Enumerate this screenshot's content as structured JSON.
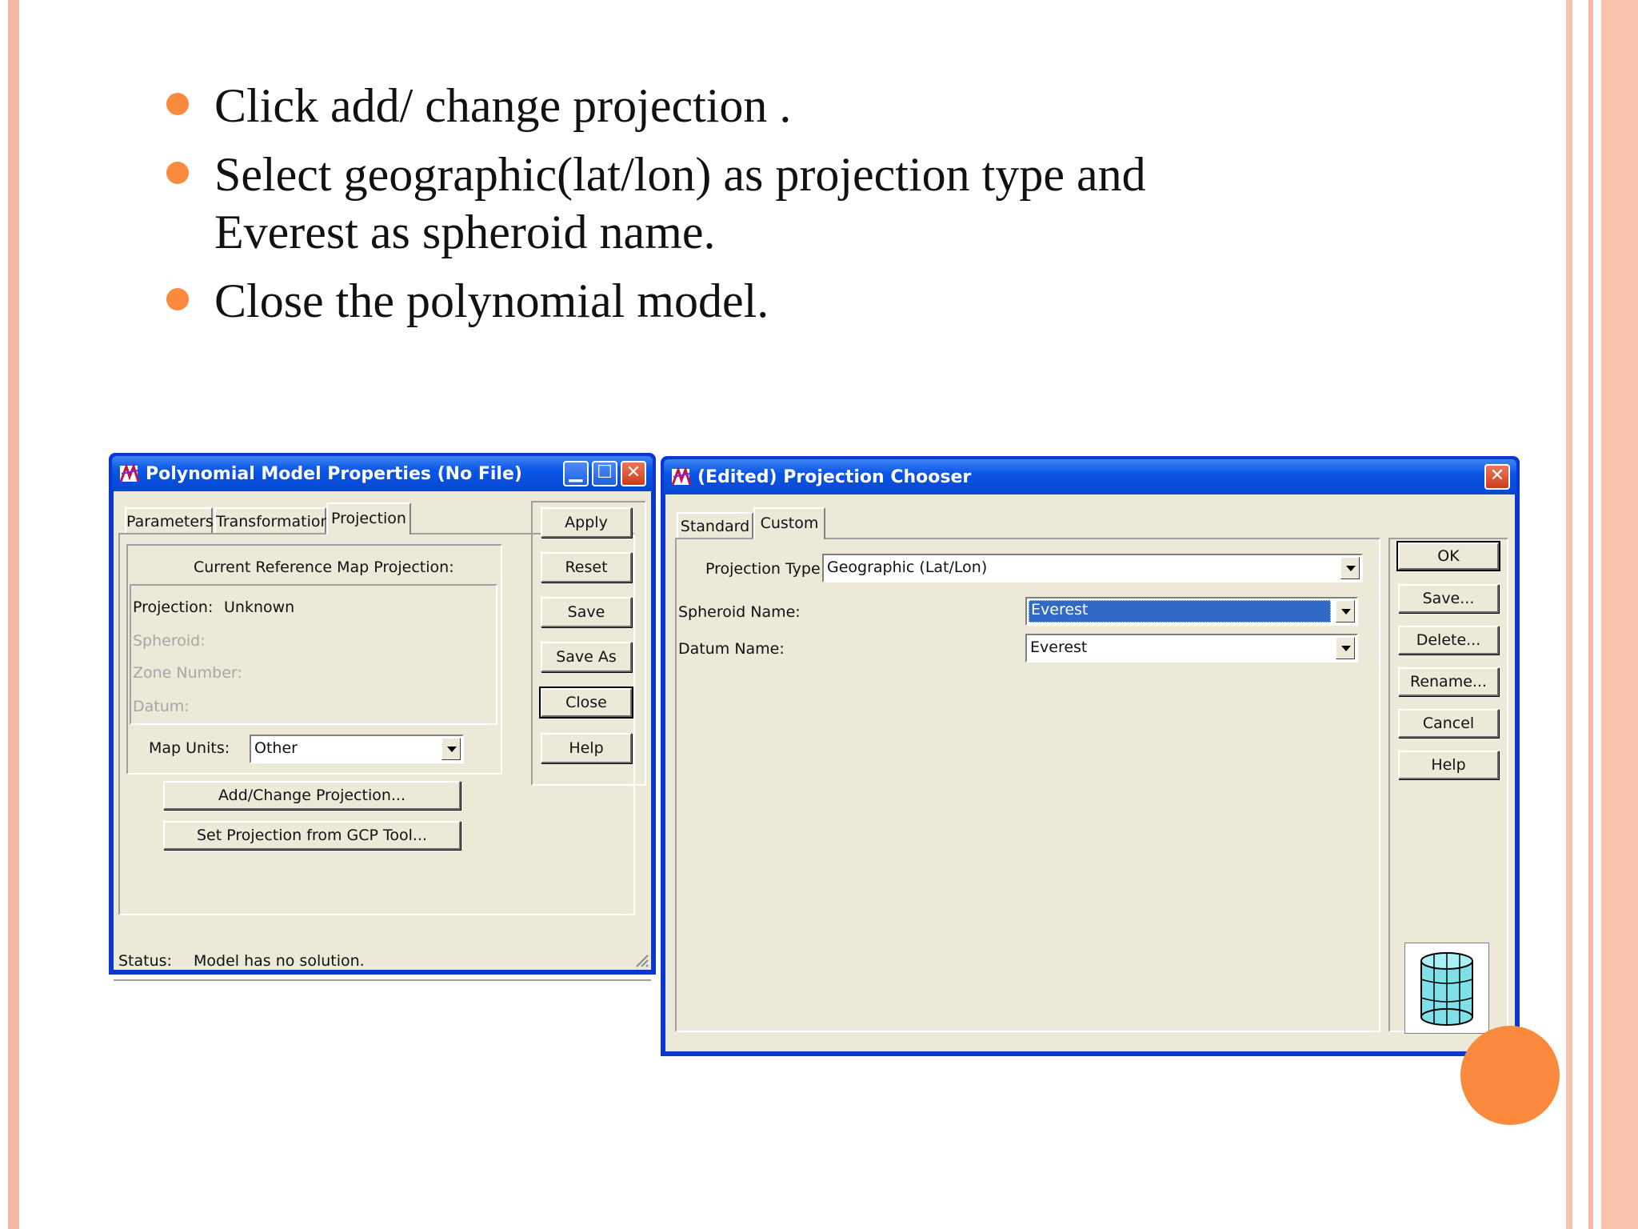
{
  "bullets": [
    "Click add/ change projection .",
    "Select geographic(lat/lon) as projection type and Everest as spheroid name.",
    "Close the polynomial model."
  ],
  "colors": {
    "accent": "#fb8a3f",
    "stripe": "#f6b7a3",
    "titlebar": "#0a55e6",
    "dialog_bg": "#ece9d8",
    "selection": "#3169c6"
  },
  "poly": {
    "title": "Polynomial Model Properties (No File)",
    "tabs": [
      "Parameters",
      "Transformation",
      "Projection"
    ],
    "group_title": "Current Reference Map Projection:",
    "projection_label": "Projection:",
    "projection_value": "Unknown",
    "spheroid_label": "Spheroid:",
    "zone_label": "Zone Number:",
    "datum_label": "Datum:",
    "map_units_label": "Map Units:",
    "map_units_value": "Other",
    "add_change_button": "Add/Change Projection...",
    "set_from_gcp_button": "Set Projection from GCP Tool...",
    "side_buttons": [
      "Apply",
      "Reset",
      "Save",
      "Save As",
      "Close",
      "Help"
    ],
    "status_label": "Status:",
    "status_value": "Model has no solution."
  },
  "chooser": {
    "title": "(Edited) Projection Chooser",
    "tabs": [
      "Standard",
      "Custom"
    ],
    "projection_type_label": "Projection Type :",
    "projection_type_value": "Geographic (Lat/Lon)",
    "spheroid_label": "Spheroid Name:",
    "spheroid_value": "Everest",
    "datum_label": "Datum Name:",
    "datum_value": "Everest",
    "side_buttons": [
      "OK",
      "Save...",
      "Delete...",
      "Rename...",
      "Cancel",
      "Help"
    ]
  }
}
